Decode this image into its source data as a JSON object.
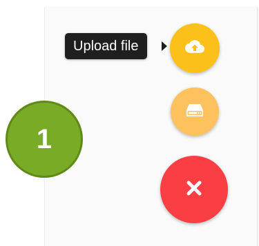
{
  "step": {
    "number": "1"
  },
  "actions": {
    "upload": {
      "tooltip": "Upload file",
      "icon": "cloud-upload-icon",
      "color": "#fbc01a"
    },
    "drive": {
      "icon": "hard-drive-icon",
      "color": "#fdc15e"
    },
    "close": {
      "icon": "close-icon",
      "color": "#f93e44"
    }
  }
}
